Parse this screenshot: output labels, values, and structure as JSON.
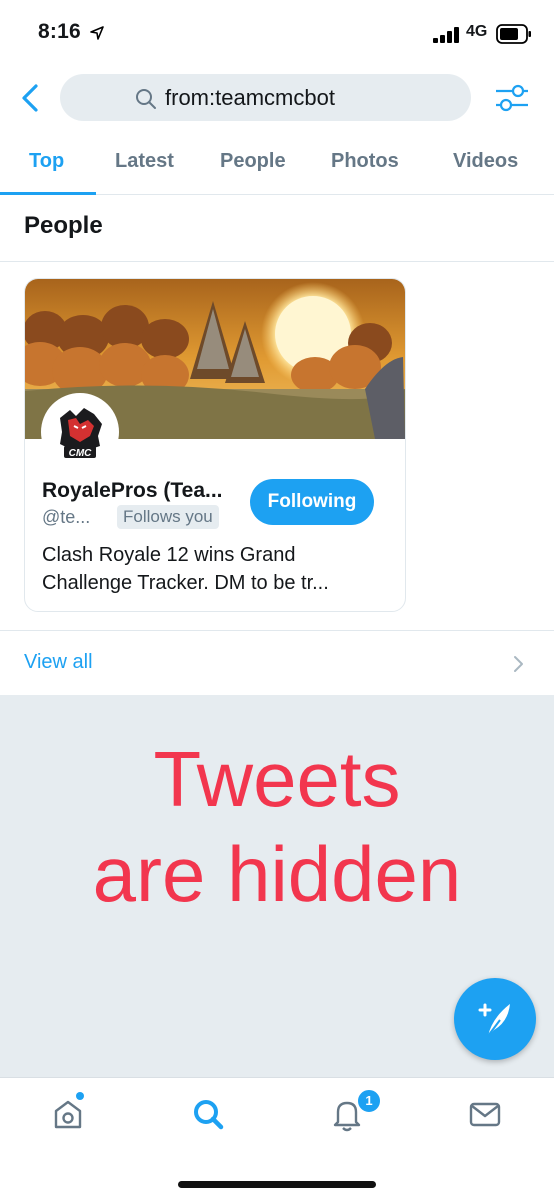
{
  "status_bar": {
    "time": "8:16",
    "network": "4G"
  },
  "search": {
    "query": "from:teamcmcbot"
  },
  "tabs": [
    {
      "label": "Top",
      "active": true
    },
    {
      "label": "Latest",
      "active": false
    },
    {
      "label": "People",
      "active": false
    },
    {
      "label": "Photos",
      "active": false
    },
    {
      "label": "Videos",
      "active": false
    }
  ],
  "people": {
    "title": "People",
    "card": {
      "name": "RoyalePros (Tea...",
      "handle": "@te...",
      "follows_badge": "Follows you",
      "follow_button": "Following",
      "bio": "Clash Royale 12 wins Grand Challenge Tracker. DM to be tr..."
    },
    "view_all": "View all"
  },
  "overlay": {
    "line1": "Tweets",
    "line2": "are hidden"
  },
  "notifications": {
    "badge_count": "1"
  },
  "colors": {
    "accent": "#1da1f2",
    "overlay_text": "#f2364e",
    "muted": "#657786",
    "background_gray": "#e6ecf0"
  },
  "icons": [
    "back-icon",
    "search-icon",
    "filter-icon",
    "compose-icon",
    "home-icon",
    "search-tab-icon",
    "bell-icon",
    "mail-icon",
    "chevron-right-icon"
  ]
}
